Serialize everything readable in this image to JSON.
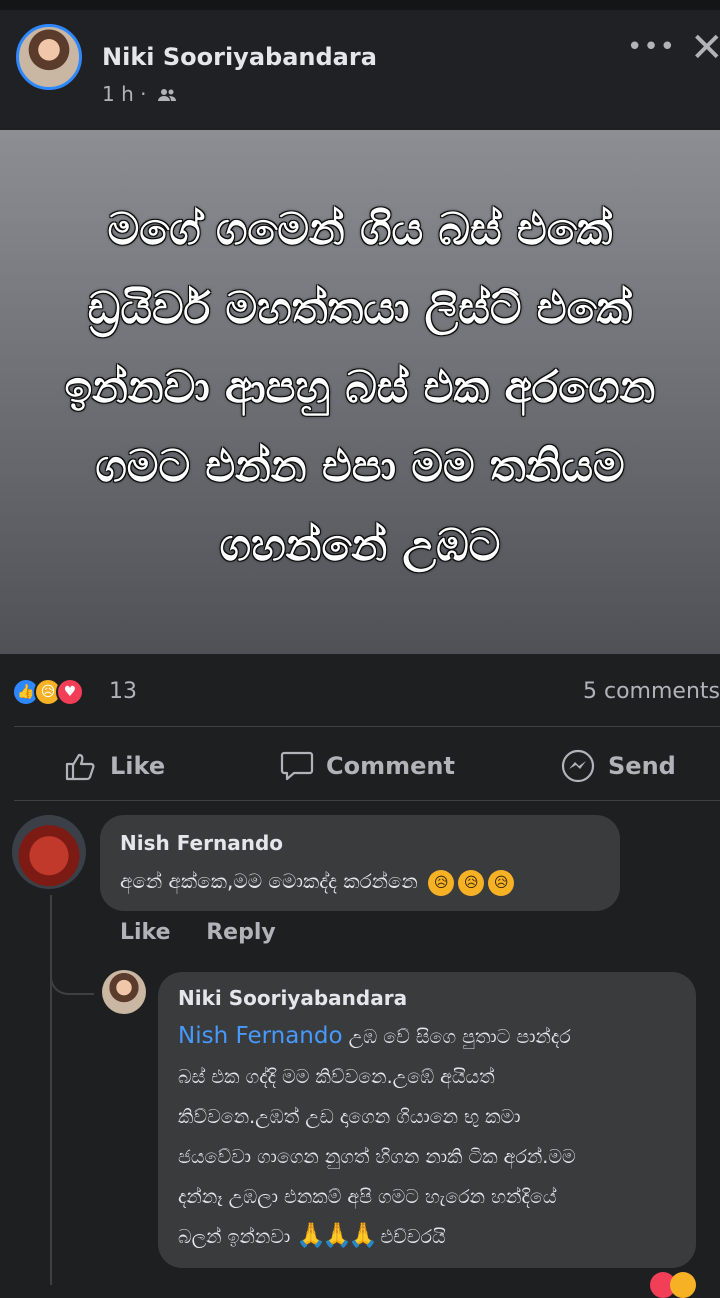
{
  "post": {
    "author": "Niki Sooriyabandara",
    "time": "1 h ·",
    "text_lines": [
      "මගේ ගමෙන් ගිය බස් එකේ",
      "ඩ්‍රයිවර් මහත්තයා ලිස්ට් එකේ",
      "ඉන්නවා ආපහු බස් එක අරගෙන",
      "ගමට එන්න එපා මම තනියම",
      "ගහන්නේ උඹට"
    ]
  },
  "stats": {
    "reaction_count": "13",
    "comments": "5 comments"
  },
  "actions": {
    "like": "Like",
    "comment": "Comment",
    "send": "Send"
  },
  "comment1": {
    "name": "Nish Fernando",
    "text": "අනේ අක්කෙ,මම මොකද්ද කරන්නෙ",
    "like": "Like",
    "reply": "Reply"
  },
  "reply1": {
    "name": "Niki Sooriyabandara",
    "mention": "Nish Fernando",
    "lines": [
      " උඹ වේ සිගෙ පුතාට පාන්දර",
      "බස් එක ගද්දි මම කිව්වනෙ.උඹේ අයියත්",
      "කිව්වනෙ.උඹත් උඩ දාගෙන ගියානෙ භු කමා",
      "ජයවේවා ගාගෙන නුගත් හිගන නාකි ටික අරන්.මම",
      "දන්නෑ උඹලා එනකම් අපි ගමට හැරෙන හන්දියේ",
      "බලන් ඉන්නවා"
    ],
    "tail": "එච්චරයි"
  },
  "icons": [
    "close-icon",
    "more-icon",
    "audience-friends-icon",
    "like-icon",
    "comment-icon",
    "messenger-icon"
  ]
}
